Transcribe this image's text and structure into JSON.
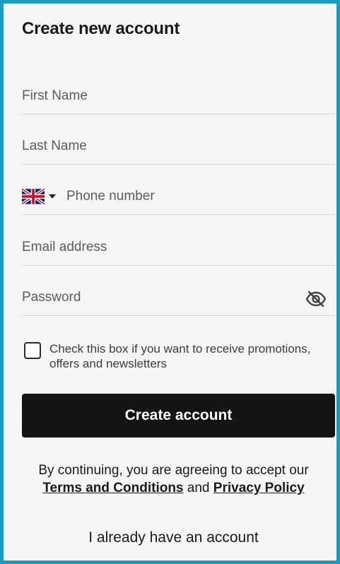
{
  "form": {
    "title": "Create new account",
    "first_name": {
      "placeholder": "First Name",
      "value": ""
    },
    "last_name": {
      "placeholder": "Last Name",
      "value": ""
    },
    "phone": {
      "placeholder": "Phone number",
      "value": "",
      "country_flag_icon": "uk-flag-icon"
    },
    "email": {
      "placeholder": "Email address",
      "value": ""
    },
    "password": {
      "placeholder": "Password",
      "value": "",
      "toggle_icon": "eye-off-icon"
    },
    "promotions_checkbox": {
      "checked": false,
      "label": "Check this box if you want to receive promotions, offers and newsletters"
    },
    "submit_label": "Create account",
    "legal": {
      "prefix": "By continuing, you are agreeing to accept our",
      "terms_label": "Terms and Conditions",
      "conjunction": "and",
      "privacy_label": "Privacy Policy"
    },
    "login_link": "I already have an account"
  },
  "colors": {
    "frame_border": "#1a9cbf",
    "background": "#f6f6f6",
    "button": "#141414",
    "button_text": "#ffffff"
  }
}
